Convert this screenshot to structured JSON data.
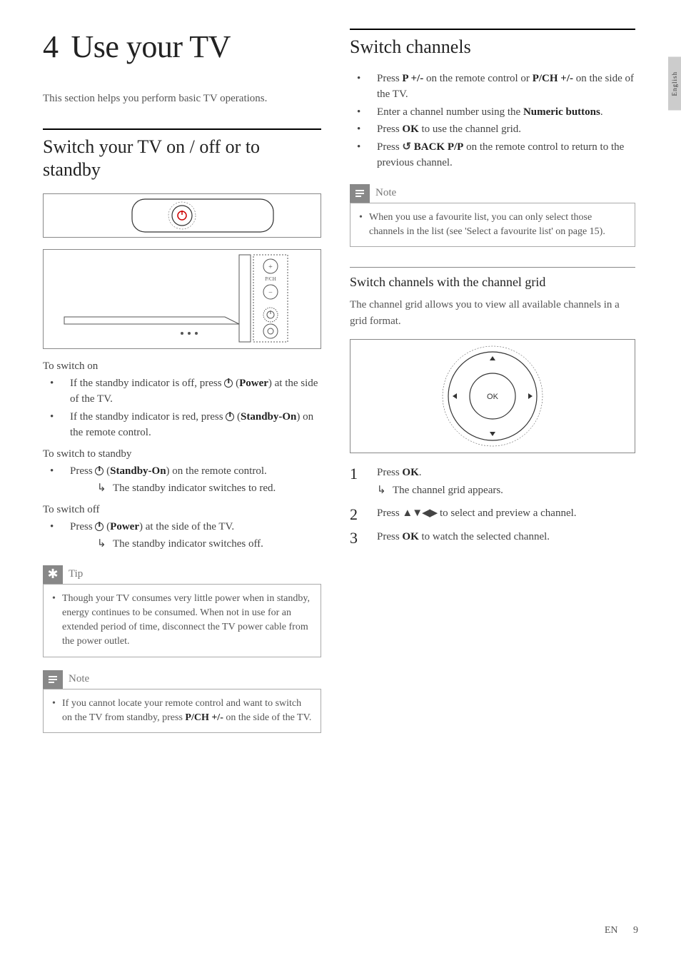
{
  "language_tab": "English",
  "chapter": {
    "number": "4",
    "title": "Use your TV"
  },
  "intro": "This section helps you perform basic TV operations.",
  "section_power": {
    "heading": "Switch your TV on / off or to standby",
    "switch_on_label": "To switch on",
    "switch_on_item1_a": "If the standby indicator is off, press ",
    "switch_on_item1_b": " (",
    "switch_on_item1_bold": "Power",
    "switch_on_item1_c": ") at the side of the TV.",
    "switch_on_item2_a": "If the standby indicator is red, press ",
    "switch_on_item2_b": " (",
    "switch_on_item2_bold": "Standby-On",
    "switch_on_item2_c": ") on the remote control.",
    "standby_label": "To switch to standby",
    "standby_item_a": "Press ",
    "standby_item_b": " (",
    "standby_item_bold": "Standby-On",
    "standby_item_c": ") on the remote control.",
    "standby_result": "The standby indicator switches to red.",
    "off_label": "To switch off",
    "off_item_a": "Press ",
    "off_item_b": " (",
    "off_item_bold": "Power",
    "off_item_c": ") at the side of the TV.",
    "off_result": "The standby indicator switches off."
  },
  "tip": {
    "label": "Tip",
    "body": "Though your TV consumes very little power when in standby, energy continues to be consumed. When not in use for an extended period of time, disconnect the TV power cable from the power outlet."
  },
  "note1": {
    "label": "Note",
    "body_a": "If you cannot locate your remote control and want to switch on the TV from standby, press ",
    "body_bold": "P/CH +/-",
    "body_b": " on the side of the TV."
  },
  "section_channels": {
    "heading": "Switch channels",
    "item1_a": "Press ",
    "item1_bold1": "P +/-",
    "item1_b": " on the remote control or ",
    "item1_bold2": "P/CH +/-",
    "item1_c": " on the side of the TV.",
    "item2_a": "Enter a channel number using the ",
    "item2_bold": "Numeric buttons",
    "item2_b": ".",
    "item3_a": "Press ",
    "item3_bold": "OK",
    "item3_b": " to use the channel grid.",
    "item4_a": "Press ",
    "item4_bold": " BACK P/P",
    "item4_b": " on the remote control to return to the previous channel."
  },
  "note2": {
    "label": "Note",
    "body": "When you use a favourite list, you can only select those channels in the list (see 'Select a favourite list' on page 15)."
  },
  "section_grid": {
    "heading": "Switch channels with the channel grid",
    "desc": "The channel grid allows you to view all available channels in a grid format.",
    "step1_a": "Press ",
    "step1_bold": "OK",
    "step1_b": ".",
    "step1_result": "The channel grid appears.",
    "step2_a": "Press ",
    "step2_b": " to select and preview a channel.",
    "step3_a": "Press ",
    "step3_bold": "OK",
    "step3_b": " to watch the selected channel."
  },
  "footer": {
    "lang": "EN",
    "page": "9"
  }
}
